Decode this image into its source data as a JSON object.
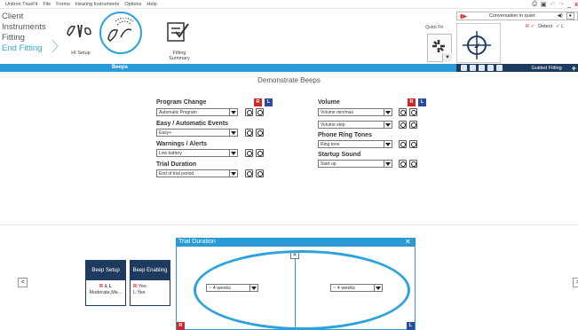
{
  "menubar": {
    "items": [
      "Unitron TrueFit",
      "File",
      "Forms",
      "Hearing Instruments",
      "Options",
      "Help"
    ]
  },
  "window_controls": {
    "minimize": "_",
    "close": "x"
  },
  "leftnav": {
    "items": [
      "Client",
      "Instruments",
      "Fitting",
      "End Fitting"
    ],
    "active": "End Fitting"
  },
  "workflow": {
    "hi_setup": "HI Setup",
    "fitting_summary_1": "Fitting",
    "fitting_summary_2": "Summary"
  },
  "quickfit": {
    "label": "Quick Fit"
  },
  "program": {
    "name": "Conversation in quiet"
  },
  "detect": {
    "r_label": "R ✓",
    "detect_label": "Detect",
    "l_label": "✓ L"
  },
  "tabs": {
    "beeps": "Beeps"
  },
  "rightbar": {
    "guided": "Guided Fitting",
    "plus": "+"
  },
  "main": {
    "title": "Demonstrate Beeps",
    "left_sections": [
      {
        "title": "Program Change",
        "value": "Automatic Program"
      },
      {
        "title": "Easy / Automatic Events",
        "value": "Easy+"
      },
      {
        "title": "Warnings / Alerts",
        "value": "Low battery"
      },
      {
        "title": "Trial Duration",
        "value": "End of trial period"
      }
    ],
    "right_sections": [
      {
        "title": "Volume",
        "value": "Volume min/max"
      },
      {
        "title": "",
        "value": "Volume step"
      },
      {
        "title": "Phone Ring Tones",
        "value": "Ring tone"
      },
      {
        "title": "Startup Sound",
        "value": "Start up"
      }
    ],
    "r_badge": "R",
    "l_badge": "L"
  },
  "cards": [
    {
      "title": "Beep Setup",
      "line1_r": "R",
      "line1_amp": " & ",
      "line1_l": "L",
      "line2": "Moderate,Me..."
    },
    {
      "title": "Beep Enabling",
      "line1_r": "R:",
      "line1_rv": "Yes",
      "line2": "L:Yes"
    }
  ],
  "nav": {
    "left": "<",
    "right": ">"
  },
  "trial_panel": {
    "title": "Trial Duration",
    "close": "✕",
    "x_btn": "✕",
    "left_value": "~ 4 weeks",
    "right_value": "~ 4 weeks",
    "r_badge": "R",
    "l_badge": "L"
  },
  "colors": {
    "accent": "#2a9ad6",
    "navy": "#1e3a5f",
    "red": "#d02828",
    "blue": "#2c4aa0"
  }
}
